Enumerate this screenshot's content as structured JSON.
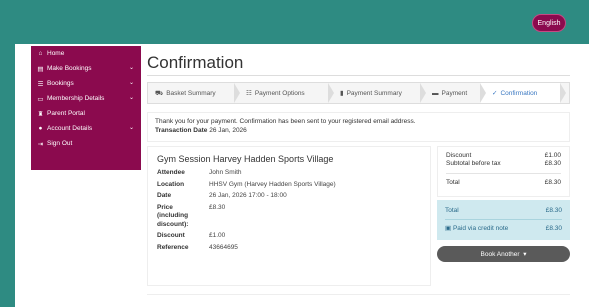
{
  "header": {
    "language_label": "English"
  },
  "sidebar": {
    "items": [
      {
        "label": "Home",
        "icon": "home-icon",
        "chevron": false
      },
      {
        "label": "Make Bookings",
        "icon": "calendar-icon",
        "chevron": true
      },
      {
        "label": "Bookings",
        "icon": "list-icon",
        "chevron": true
      },
      {
        "label": "Membership Details",
        "icon": "card-icon",
        "chevron": true
      },
      {
        "label": "Parent Portal",
        "icon": "trophy-icon",
        "chevron": false
      },
      {
        "label": "Account Details",
        "icon": "user-icon",
        "chevron": true
      },
      {
        "label": "Sign Out",
        "icon": "signout-icon",
        "chevron": false
      }
    ]
  },
  "page": {
    "title": "Confirmation"
  },
  "steps": [
    {
      "label": "Basket Summary",
      "icon": "cart-icon"
    },
    {
      "label": "Payment Options",
      "icon": "list-icon"
    },
    {
      "label": "Payment Summary",
      "icon": "doc-icon"
    },
    {
      "label": "Payment",
      "icon": "card-icon"
    },
    {
      "label": "Confirmation",
      "icon": "check-icon"
    }
  ],
  "message": {
    "text": "Thank you for your payment. Confirmation has been sent to your registered email address.",
    "date_label": "Transaction Date",
    "date_value": "26 Jan, 2026"
  },
  "booking": {
    "title": "Gym Session Harvey Hadden Sports Village",
    "rows": [
      {
        "key": "Attendee",
        "value": "John Smith"
      },
      {
        "key": "Location",
        "value": "HHSV Gym (Harvey Hadden Sports Village)"
      },
      {
        "key": "Date",
        "value": "26 Jan, 2026 17:00 - 18:00"
      },
      {
        "key": "Price (including discount):",
        "value": "£8.30"
      },
      {
        "key": "Discount",
        "value": "£1.00"
      },
      {
        "key": "Reference",
        "value": "43664695"
      }
    ]
  },
  "summary": {
    "discount_label": "Discount",
    "discount_value": "£1.00",
    "subtotal_label": "Subtotal before tax",
    "subtotal_value": "£8.30",
    "total_label": "Total",
    "total_value": "£8.30"
  },
  "total_box": {
    "total_label": "Total",
    "total_value": "£8.30",
    "paid_label": "Paid via credit note",
    "paid_value": "£8.30"
  },
  "book_another_label": "Book Another",
  "colors": {
    "brand": "#8b0a4e",
    "teal": "#2e8b82",
    "accent": "#3a78c2"
  }
}
